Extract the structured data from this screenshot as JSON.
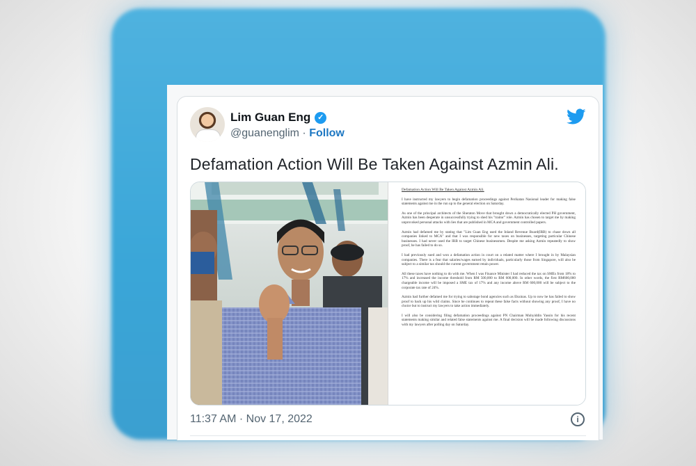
{
  "tweet": {
    "author_name": "Lim Guan Eng",
    "handle": "@guanenglim",
    "separator": "·",
    "follow_label": "Follow",
    "text": "Defamation Action Will Be Taken Against Azmin Ali.",
    "timestamp": "11:37 AM · Nov 17, 2022"
  },
  "document": {
    "title": "Defamation Action Will Be Taken Against Azmin Ali.",
    "paragraphs": [
      "I have instructed my lawyers to begin defamation proceedings against Perikatan Nasional leader for making false statements against me in the run up to the general election on Saturday.",
      "As one of the principal architects of the Sheraton Move that brought down a democratically elected PH government, Azmin has been desperate in unsuccessfully trying to shed his \"traitor\" role. Azmin has chosen to target me by making unprovoked personal attacks with lies that are published in MCA and government controlled papers.",
      "Azmin had defamed me by stating that \"Lim Guan Eng used the Inland Revenue Board(IRB) to chase down all companies linked to MCA\" and that I was responsible for new taxes on businesses, targeting particular Chinese businesses. I had never used the IRB to target Chinese businessmen. Despite me asking Azmin repeatedly to show proof, he has failed to do so.",
      "I had previously sued and won a defamation action in court on a related matter where I brought in by Malaysian companies. There is a fear that salaries/wages earned by individuals, particularly those from Singapore, will also be subject to a similar tax should the current government retain power.",
      "All these taxes have nothing to do with me. When I was Finance Minister I had reduced the tax on SMEs from 18% to 17% and increased the income threshold from RM 500,000 to RM 600,000. In other words, the first RM600,000 chargeable income will be imposed a SME tax of 17% and any income above RM 600,000 will be subject to the corporate tax rate of 24%.",
      "Azmin had further defamed me for trying to sabotage bond agencies such as Ekuinas. Up to now he has failed to show proof to back up his wild claims. Since he continues to repeat these false facts without showing any proof, I have no choice but to instruct my lawyers to take action immediately.",
      "I will also be considering filing defamation proceedings against PN Chairman Muhyiddin Yassin for his recent statements making similar and related false statements against me. A final decision will be made following discussions with my lawyers after polling day on Saturday."
    ]
  },
  "colors": {
    "accent": "#1d9bf0",
    "follow_link": "#1d77c2",
    "background_card": "#3aa6d8"
  },
  "icons": {
    "verified": "verified-badge-icon",
    "brand": "twitter-bird-icon",
    "info": "info-icon"
  }
}
